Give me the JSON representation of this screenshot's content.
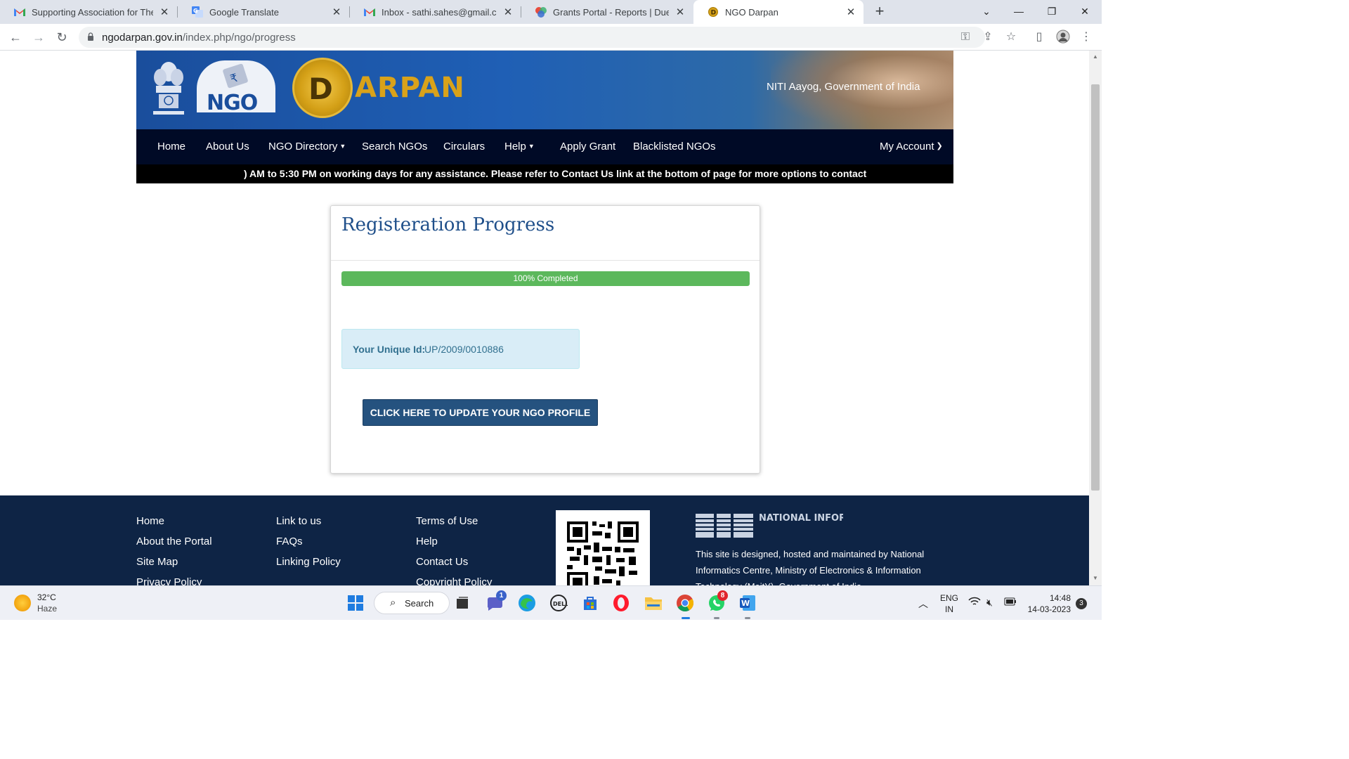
{
  "browser": {
    "tabs": [
      {
        "title": "Supporting Association for Them",
        "icon": "gmail-icon"
      },
      {
        "title": "Google Translate",
        "icon": "google-translate-icon"
      },
      {
        "title": "Inbox - sathi.sahes@gmail.com -",
        "icon": "gmail-icon"
      },
      {
        "title": "Grants Portal - Reports | Due Rep",
        "icon": "grants-portal-icon"
      },
      {
        "title": "NGO Darpan",
        "icon": "darpan-icon",
        "active": true
      }
    ],
    "url_domain": "ngodarpan.gov.in",
    "url_path": "/index.php/ngo/progress"
  },
  "site": {
    "header_right_text": "NITI Aayog, Government of India",
    "nav": [
      {
        "label": "Home"
      },
      {
        "label": "About Us"
      },
      {
        "label": "NGO Directory",
        "dropdown": true
      },
      {
        "label": "Search NGOs"
      },
      {
        "label": "Circulars"
      },
      {
        "label": "Help",
        "dropdown": true
      },
      {
        "label": "Apply Grant"
      },
      {
        "label": "Blacklisted NGOs"
      }
    ],
    "account_label": "My Account",
    "marquee_text": ") AM to 5:30 PM on working days for any assistance. Please refer to Contact Us link at the bottom of page for more options to contact"
  },
  "progress_card": {
    "title": "Registeration Progress",
    "progress_percent": 100,
    "progress_label": "100% Completed",
    "unique_id_label": "Your Unique Id:",
    "unique_id_value": "UP/2009/0010886",
    "update_button": "CLICK HERE TO UPDATE YOUR NGO PROFILE"
  },
  "footer": {
    "col1": [
      "Home",
      "About the Portal",
      "Site Map",
      "Privacy Policy"
    ],
    "col2": [
      "Link to us",
      "FAQs",
      "Linking Policy"
    ],
    "col3": [
      "Terms of Use",
      "Help",
      "Contact Us",
      "Copyright Policy"
    ],
    "nic_logo_text": "NATIONAL INFORMATICS CENTRE",
    "nic_description": "This site is designed, hosted and maintained by National Informatics Centre, Ministry of Electronics & Information Technology (MeitY), Government of India."
  },
  "taskbar": {
    "weather_temp": "32°C",
    "weather_desc": "Haze",
    "search_label": "Search",
    "teams_badge": "1",
    "whatsapp_badge": "8",
    "lang_line1": "ENG",
    "lang_line2": "IN",
    "time": "14:48",
    "date": "14-03-2023",
    "notification_count": "3"
  },
  "colors": {
    "nav_bg": "#000a26",
    "footer_bg": "#0e2445",
    "progress_fill": "#5cb85c",
    "button_bg": "#25527f",
    "title_color": "#1f4f8a"
  }
}
